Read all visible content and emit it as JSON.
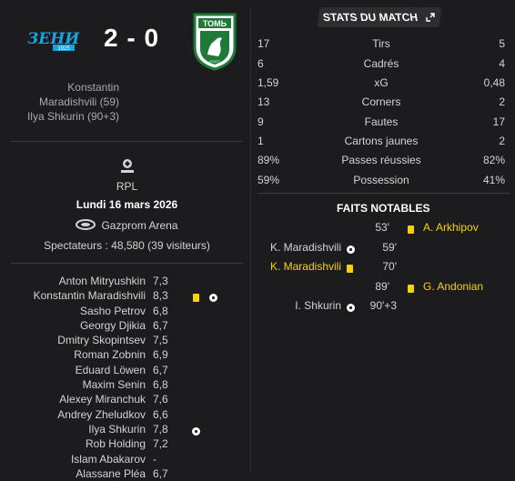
{
  "match": {
    "home_score": "2",
    "away_score": "0",
    "separator": "-",
    "home_team_logo_text": "ЗЕНИТ",
    "home_team_logo_year": "1925",
    "away_team_logo_text": "ТОМЬ",
    "away_team_logo_year": "FOOT",
    "home_scorers": [
      "Konstantin",
      "Maradishvili (59)",
      "Ilya Shkurin (90+3)"
    ],
    "competition": "RPL",
    "date": "Lundi 16 mars 2026",
    "stadium": "Gazprom Arena",
    "attendance": "Spectateurs : 48,580 (39 visiteurs)"
  },
  "players": [
    {
      "name": "Anton Mitryushkin",
      "rating": "7,3",
      "events": []
    },
    {
      "name": "Konstantin Maradishvili",
      "rating": "8,3",
      "events": [
        "yellow-card",
        "goal"
      ]
    },
    {
      "name": "Sasho Petrov",
      "rating": "6,8",
      "events": []
    },
    {
      "name": "Georgy Djikia",
      "rating": "6,7",
      "events": []
    },
    {
      "name": "Dmitry Skopintsev",
      "rating": "7,5",
      "events": []
    },
    {
      "name": "Roman Zobnin",
      "rating": "6,9",
      "events": []
    },
    {
      "name": "Eduard Löwen",
      "rating": "6,7",
      "events": []
    },
    {
      "name": "Maxim Senin",
      "rating": "6,8",
      "events": []
    },
    {
      "name": "Alexey Miranchuk",
      "rating": "7,6",
      "events": []
    },
    {
      "name": "Andrey Zheludkov",
      "rating": "6,6",
      "events": []
    },
    {
      "name": "Ilya Shkurin",
      "rating": "7,8",
      "events": [
        "goal"
      ]
    },
    {
      "name": "Rob Holding",
      "rating": "7,2",
      "events": []
    },
    {
      "name": "Islam Abakarov",
      "rating": "-",
      "events": []
    },
    {
      "name": "Alassane Pléa",
      "rating": "6,7",
      "events": []
    }
  ],
  "stats": {
    "title": "STATS DU MATCH",
    "rows": [
      {
        "home": "17",
        "label": "Tirs",
        "away": "5"
      },
      {
        "home": "6",
        "label": "Cadrés",
        "away": "4"
      },
      {
        "home": "1,59",
        "label": "xG",
        "away": "0,48"
      },
      {
        "home": "13",
        "label": "Corners",
        "away": "2"
      },
      {
        "home": "9",
        "label": "Fautes",
        "away": "17"
      },
      {
        "home": "1",
        "label": "Cartons jaunes",
        "away": "2"
      },
      {
        "home": "89%",
        "label": "Passes réussies",
        "away": "82%"
      },
      {
        "home": "59%",
        "label": "Possession",
        "away": "41%"
      }
    ]
  },
  "faits": {
    "title": "FAITS NOTABLES",
    "rows": [
      {
        "minute": "53'",
        "side": "away",
        "type": "yellow-card",
        "player": "A. Arkhipov"
      },
      {
        "minute": "59'",
        "side": "home",
        "type": "goal",
        "player": "K. Maradishvili"
      },
      {
        "minute": "70'",
        "side": "home",
        "type": "yellow-card",
        "player": "K. Maradishvili"
      },
      {
        "minute": "89'",
        "side": "away",
        "type": "yellow-card",
        "player": "G. Andonian"
      },
      {
        "minute": "90'+3",
        "side": "home",
        "type": "goal",
        "player": "I. Shkurin"
      }
    ]
  },
  "colors": {
    "background": "#1c1c1e",
    "yellow_card": "#f5d20a",
    "zenit_blue": "#1aa3e0",
    "tom_green": "#1f7a3a"
  }
}
